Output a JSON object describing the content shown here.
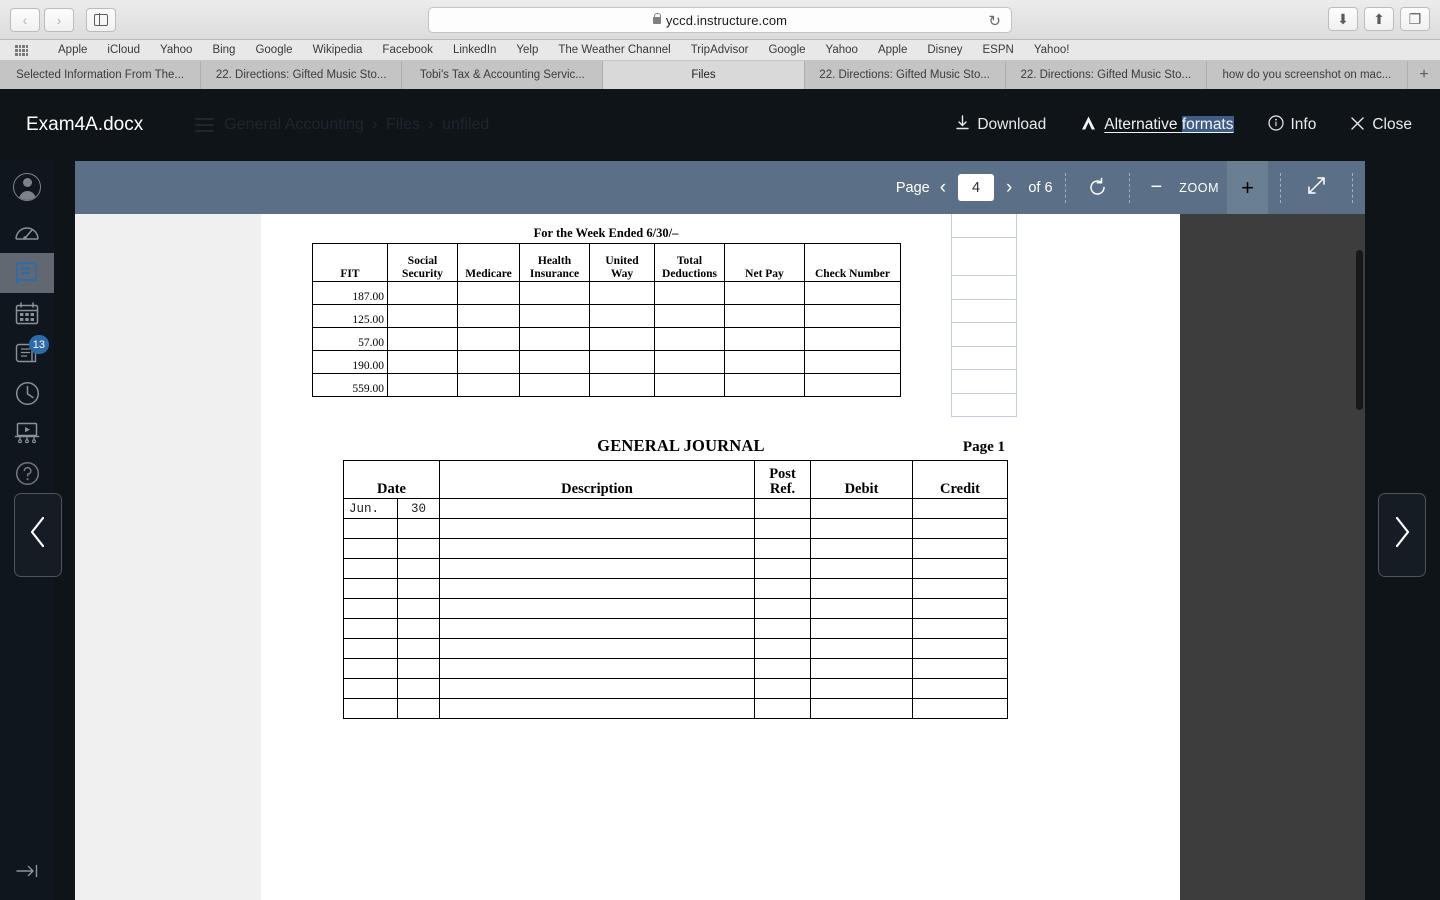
{
  "browser": {
    "url": "yccd.instructure.com",
    "back_icon": "‹",
    "forward_icon": "›",
    "sidebar_icon": "sidebar-icon",
    "reload_icon": "↻",
    "downloads_icon": "⬇",
    "share_icon": "⬆",
    "tabs_overview_icon": "❐",
    "new_tab_icon": "+",
    "bookmarks": [
      "Apple",
      "iCloud",
      "Yahoo",
      "Bing",
      "Google",
      "Wikipedia",
      "Facebook",
      "LinkedIn",
      "Yelp",
      "The Weather Channel",
      "TripAdvisor",
      "Google",
      "Yahoo",
      "Apple",
      "Disney",
      "ESPN",
      "Yahoo!"
    ],
    "tabs": [
      {
        "label": "Selected Information From The...",
        "active": false
      },
      {
        "label": "22. Directions: Gifted Music Sto...",
        "active": false
      },
      {
        "label": "Tobi's Tax & Accounting Servic...",
        "active": false
      },
      {
        "label": "Files",
        "active": true
      },
      {
        "label": "22. Directions: Gifted Music Sto...",
        "active": false
      },
      {
        "label": "22. Directions: Gifted Music Sto...",
        "active": false
      },
      {
        "label": "how do you screenshot on mac...",
        "active": false
      }
    ]
  },
  "preview": {
    "file_name": "Exam4A.docx",
    "breadcrumb": [
      "General Accounting",
      "Files",
      "unfiled"
    ],
    "breadcrumb_separator": "›",
    "download_label": "Download",
    "download_icon": "download-icon",
    "alt_formats_label_plain": "Alternative ",
    "alt_formats_label_selected": "formats",
    "alt_formats_icon": "accessibility-icon",
    "info_label": "Info",
    "info_icon": "info-icon",
    "close_label": "Close",
    "close_icon": "close-icon"
  },
  "toolbar": {
    "page_label": "Page",
    "prev_icon": "‹",
    "next_icon": "›",
    "current_page": "4",
    "total_pages_label": "of 6",
    "rotate_icon": "↻",
    "zoom_out_icon": "−",
    "zoom_label": "ZOOM",
    "zoom_in_icon": "+",
    "fullscreen_icon": "⤢"
  },
  "global_nav": {
    "items": [
      {
        "name": "account",
        "icon": "avatar-icon",
        "badge": null,
        "active": false
      },
      {
        "name": "dashboard",
        "icon": "dashboard-gauge-icon",
        "badge": null,
        "active": false
      },
      {
        "name": "courses",
        "icon": "book-icon",
        "badge": null,
        "active": true
      },
      {
        "name": "calendar",
        "icon": "calendar-icon",
        "badge": null,
        "active": false
      },
      {
        "name": "inbox",
        "icon": "inbox-icon",
        "badge": "13",
        "active": false
      },
      {
        "name": "history",
        "icon": "clock-icon",
        "badge": null,
        "active": false
      },
      {
        "name": "studio",
        "icon": "studio-screen-icon",
        "badge": null,
        "active": false
      },
      {
        "name": "help",
        "icon": "question-circle-icon",
        "badge": null,
        "active": false
      }
    ],
    "collapse_icon": "→|"
  },
  "pagenav": {
    "prev_icon": "‹",
    "next_icon": "›"
  },
  "document": {
    "payroll": {
      "title": "For the Week Ended 6/30/–",
      "headers": [
        "FIT",
        "Social Security",
        "Medicare",
        "Health Insurance",
        "United Way",
        "Total Deductions",
        "Net Pay",
        "Check Number"
      ],
      "headers_wrapped": [
        [
          "",
          "FIT"
        ],
        [
          "Social",
          "Security"
        ],
        [
          "",
          "Medicare"
        ],
        [
          "Health",
          "Insurance"
        ],
        [
          "United",
          "Way"
        ],
        [
          "Total",
          "Deductions"
        ],
        [
          "",
          "Net Pay"
        ],
        [
          "",
          "Check Number"
        ]
      ],
      "rows": [
        [
          "187.00",
          "",
          "",
          "",
          "",
          "",
          "",
          ""
        ],
        [
          "125.00",
          "",
          "",
          "",
          "",
          "",
          "",
          ""
        ],
        [
          "57.00",
          "",
          "",
          "",
          "",
          "",
          "",
          ""
        ],
        [
          "190.00",
          "",
          "",
          "",
          "",
          "",
          "",
          ""
        ],
        [
          "559.00",
          "",
          "",
          "",
          "",
          "",
          "",
          ""
        ]
      ]
    },
    "journal": {
      "title": "GENERAL JOURNAL",
      "page_label": "Page 1",
      "headers_wrapped": [
        [
          "",
          "Date"
        ],
        [
          "",
          "Description"
        ],
        [
          "Post",
          "Ref."
        ],
        [
          "",
          "Debit"
        ],
        [
          "",
          "Credit"
        ]
      ],
      "rows": [
        {
          "month": "Jun.",
          "day": "30",
          "description": "",
          "post_ref": "",
          "debit": "",
          "credit": ""
        },
        {
          "month": "",
          "day": "",
          "description": "",
          "post_ref": "",
          "debit": "",
          "credit": ""
        },
        {
          "month": "",
          "day": "",
          "description": "",
          "post_ref": "",
          "debit": "",
          "credit": ""
        },
        {
          "month": "",
          "day": "",
          "description": "",
          "post_ref": "",
          "debit": "",
          "credit": ""
        },
        {
          "month": "",
          "day": "",
          "description": "",
          "post_ref": "",
          "debit": "",
          "credit": ""
        },
        {
          "month": "",
          "day": "",
          "description": "",
          "post_ref": "",
          "debit": "",
          "credit": ""
        },
        {
          "month": "",
          "day": "",
          "description": "",
          "post_ref": "",
          "debit": "",
          "credit": ""
        },
        {
          "month": "",
          "day": "",
          "description": "",
          "post_ref": "",
          "debit": "",
          "credit": ""
        },
        {
          "month": "",
          "day": "",
          "description": "",
          "post_ref": "",
          "debit": "",
          "credit": ""
        },
        {
          "month": "",
          "day": "",
          "description": "",
          "post_ref": "",
          "debit": "",
          "credit": ""
        },
        {
          "month": "",
          "day": "",
          "description": "",
          "post_ref": "",
          "debit": "",
          "credit": ""
        }
      ]
    }
  },
  "colors": {
    "preview_header_bg": "#0f1419",
    "toolbar_bg": "#5b7086",
    "viewport_bg": "#3d3d3d",
    "nav_active": "#626871",
    "badge_blue": "#2d6ca8",
    "selection_blue": "#3e5c86"
  }
}
